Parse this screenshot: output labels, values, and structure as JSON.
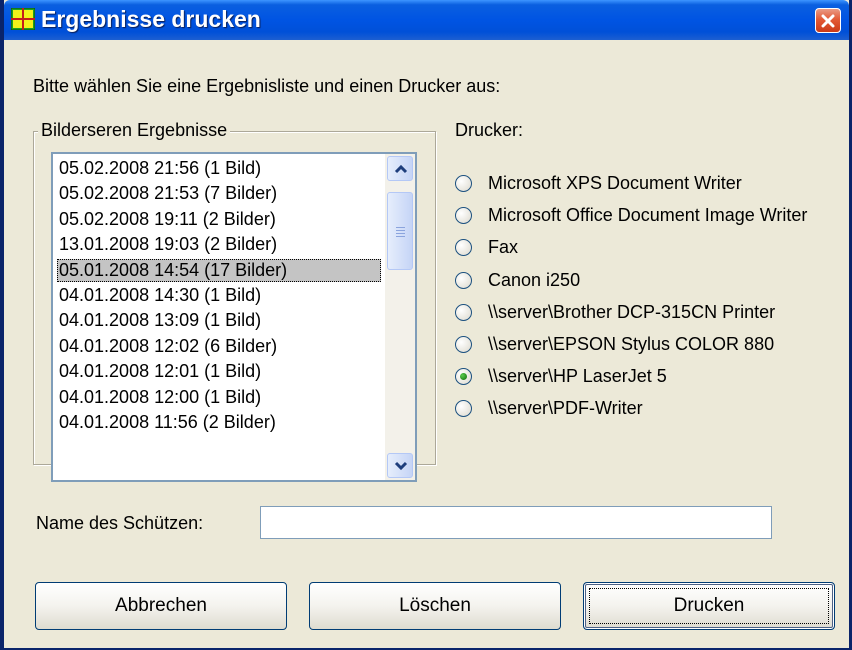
{
  "window": {
    "title": "Ergebnisse drucken",
    "title_bar_color": "#0054e3",
    "close_color": "#e35a36"
  },
  "instruction": "Bitte wählen Sie eine Ergebnisliste und einen Drucker aus:",
  "results_group": {
    "legend": "Bilderseren Ergebnisse",
    "items": [
      "05.02.2008 21:56 (1 Bild)",
      "05.02.2008 21:53 (7 Bilder)",
      "05.02.2008 19:11 (2 Bilder)",
      "13.01.2008 19:03 (2 Bilder)",
      "05.01.2008 14:54 (17 Bilder)",
      "04.01.2008 14:30 (1 Bild)",
      "04.01.2008 13:09 (1 Bild)",
      "04.01.2008 12:02 (6 Bilder)",
      "04.01.2008 12:01 (1 Bild)",
      "04.01.2008 12:00 (1 Bild)",
      "04.01.2008 11:56 (2 Bilder)"
    ],
    "selected_index": 4
  },
  "printers": {
    "label": "Drucker:",
    "options": [
      "Microsoft XPS Document Writer",
      "Microsoft Office Document Image Writer",
      "Fax",
      "Canon i250",
      "\\\\server\\Brother DCP-315CN Printer",
      "\\\\server\\EPSON Stylus COLOR 880",
      "\\\\server\\HP LaserJet 5",
      "\\\\server\\PDF-Writer"
    ],
    "selected_index": 6
  },
  "shooter": {
    "label": "Name des Schützen:",
    "value": ""
  },
  "buttons": {
    "cancel": "Abbrechen",
    "delete": "Löschen",
    "print": "Drucken"
  }
}
